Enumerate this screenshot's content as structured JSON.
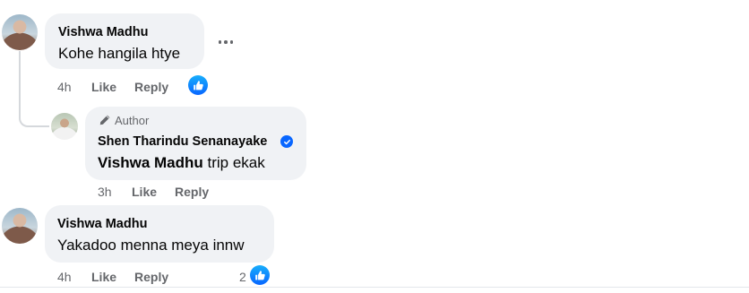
{
  "comments": [
    {
      "author": "Vishwa Madhu",
      "text": "Kohe hangila htye",
      "time": "4h",
      "like_label": "Like",
      "reply_label": "Reply"
    },
    {
      "badge_label": "Author",
      "author": "Shen Tharindu Senanayake",
      "mention": "Vishwa Madhu",
      "text": " trip ekak",
      "time": "3h",
      "like_label": "Like",
      "reply_label": "Reply"
    },
    {
      "author": "Vishwa Madhu",
      "text": "Yakadoo menna meya innw",
      "time": "4h",
      "like_label": "Like",
      "reply_label": "Reply",
      "reaction_count": "2"
    }
  ],
  "icons": {
    "more": "more-options-icon",
    "like": "thumbs-up-icon",
    "author_badge": "pencil-icon",
    "verified": "verified-check-icon"
  },
  "colors": {
    "bubble": "#f0f2f5",
    "meta_text": "#65676b",
    "accent_blue": "#0866ff"
  }
}
